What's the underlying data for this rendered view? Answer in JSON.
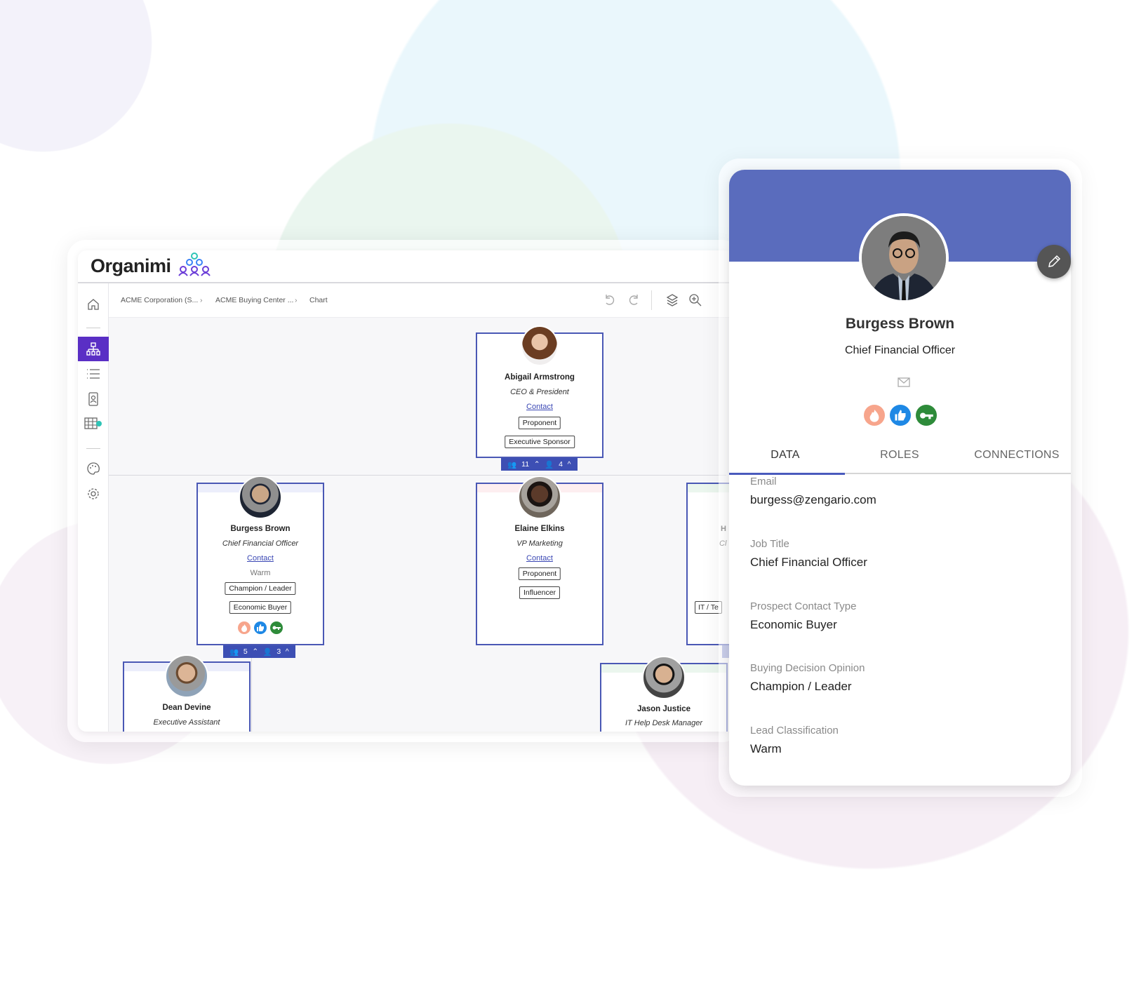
{
  "app": {
    "logo_text": "Organimi"
  },
  "breadcrumb": [
    "ACME Corporation (S...",
    "ACME Buying Center ...",
    "Chart"
  ],
  "sidebar": {
    "items": [
      {
        "icon": "home-icon"
      },
      {
        "icon": "org-chart-icon",
        "active": true
      },
      {
        "icon": "list-icon"
      },
      {
        "icon": "directory-icon"
      },
      {
        "icon": "table-icon"
      },
      {
        "icon": "palette-icon"
      },
      {
        "icon": "settings-icon"
      }
    ]
  },
  "toolbar": [
    "undo-icon",
    "redo-icon",
    "layers-icon",
    "zoom-in-icon"
  ],
  "cards": {
    "abigail": {
      "name": "Abigail Armstrong",
      "title": "CEO & President",
      "contact": "Contact",
      "tags": [
        "Proponent",
        "Executive Sponsor"
      ],
      "footer": {
        "reports": "11",
        "people": "4"
      }
    },
    "burgess": {
      "name": "Burgess Brown",
      "title": "Chief Financial Officer",
      "contact": "Contact",
      "classification": "Warm",
      "tags": [
        "Champion / Leader",
        "Economic Buyer"
      ],
      "footer": {
        "reports": "5",
        "people": "3"
      },
      "icons": [
        "flame-icon",
        "thumbs-up-icon",
        "key-icon"
      ]
    },
    "elaine": {
      "name": "Elaine Elkins",
      "title": "VP Marketing",
      "contact": "Contact",
      "tags": [
        "Proponent",
        "Influencer"
      ]
    },
    "partial": {
      "name": "H",
      "title": "Cl",
      "tag": "IT / Te"
    },
    "dean": {
      "name": "Dean Devine",
      "title": "Executive Assistant"
    },
    "jason": {
      "name": "Jason Justice",
      "title": "IT Help Desk Manager"
    }
  },
  "panel": {
    "name": "Burgess Brown",
    "title": "Chief Financial Officer",
    "icons": [
      "flame-icon",
      "thumbs-up-icon",
      "key-icon"
    ],
    "tabs": [
      "DATA",
      "ROLES",
      "CONNECTIONS"
    ],
    "active_tab": "DATA",
    "fields": [
      {
        "label": "Email",
        "value": "burgess@zengario.com"
      },
      {
        "label": "Job Title",
        "value": "Chief Financial Officer"
      },
      {
        "label": "Prospect Contact Type",
        "value": "Economic Buyer"
      },
      {
        "label": "Buying Decision Opinion",
        "value": "Champion / Leader"
      },
      {
        "label": "Lead Classification",
        "value": "Warm"
      }
    ]
  },
  "colors": {
    "brand": "#5a2fc5",
    "panel_header": "#5a6cbd",
    "card_border": "#4a58b5",
    "flame": "#f7a58c",
    "thumb": "#1e88e5",
    "key": "#2e8b3a"
  }
}
